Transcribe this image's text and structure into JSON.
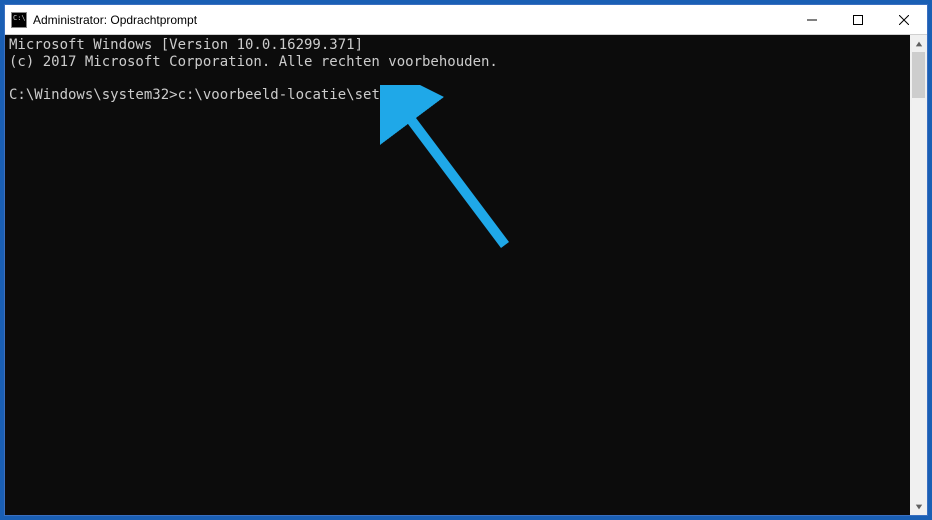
{
  "titlebar": {
    "title": "Administrator: Opdrachtprompt"
  },
  "terminal": {
    "line1": "Microsoft Windows [Version 10.0.16299.371]",
    "line2": "(c) 2017 Microsoft Corporation. Alle rechten voorbehouden.",
    "prompt": "C:\\Windows\\system32>",
    "command": "c:\\voorbeeld-locatie\\setup.exe"
  },
  "annotation": {
    "arrow_color": "#1fa8e8"
  }
}
